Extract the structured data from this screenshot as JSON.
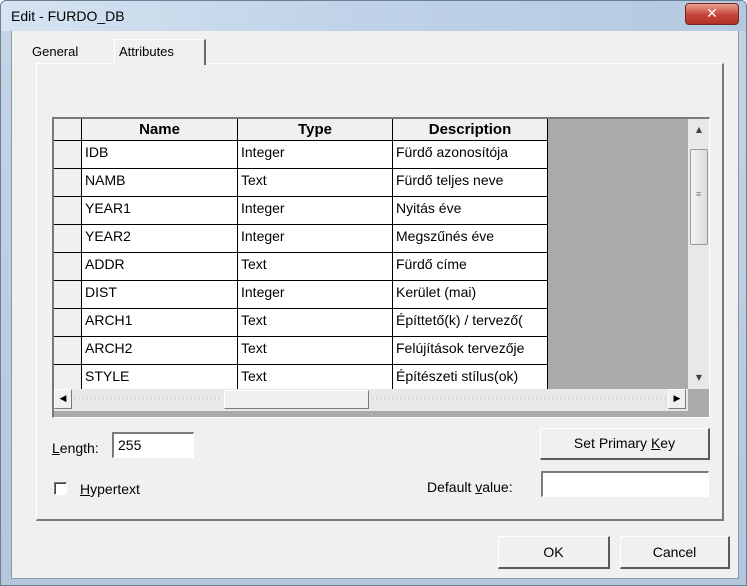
{
  "window": {
    "title": "Edit - FURDO_DB",
    "close_glyph": "✕"
  },
  "tabs": [
    {
      "label": "General",
      "active": false
    },
    {
      "label": "Attributes",
      "active": true
    }
  ],
  "grid": {
    "columns": [
      "Name",
      "Type",
      "Description"
    ],
    "rows": [
      {
        "name": "IDB",
        "type": "Integer",
        "description": "Fürdő azonosítója"
      },
      {
        "name": "NAMB",
        "type": "Text",
        "description": "Fürdő teljes neve"
      },
      {
        "name": "YEAR1",
        "type": "Integer",
        "description": "Nyitás éve"
      },
      {
        "name": "YEAR2",
        "type": "Integer",
        "description": "Megszűnés éve"
      },
      {
        "name": "ADDR",
        "type": "Text",
        "description": "Fürdő címe"
      },
      {
        "name": "DIST",
        "type": "Integer",
        "description": "Kerület (mai)"
      },
      {
        "name": "ARCH1",
        "type": "Text",
        "description": "Építtető(k) / tervező("
      },
      {
        "name": "ARCH2",
        "type": "Text",
        "description": "Felújítások tervezője"
      },
      {
        "name": "STYLE",
        "type": "Text",
        "description": "Építészeti stílus(ok)"
      }
    ],
    "scroll_up_glyph": "▲",
    "scroll_down_glyph": "▼",
    "scroll_left_glyph": "◀",
    "scroll_right_glyph": "▶"
  },
  "length": {
    "label_prefix": "L",
    "label_rest": "ength:",
    "value": "255"
  },
  "hypertext": {
    "label_prefix": "H",
    "label_rest": "ypertext",
    "checked": false
  },
  "set_primary_key": {
    "label_main": "Set Primary ",
    "label_accel": "K",
    "label_rest": "ey"
  },
  "default_value": {
    "label_main": "Default ",
    "label_accel": "v",
    "label_rest": "alue:",
    "value": ""
  },
  "buttons": {
    "ok": "OK",
    "cancel": "Cancel"
  }
}
